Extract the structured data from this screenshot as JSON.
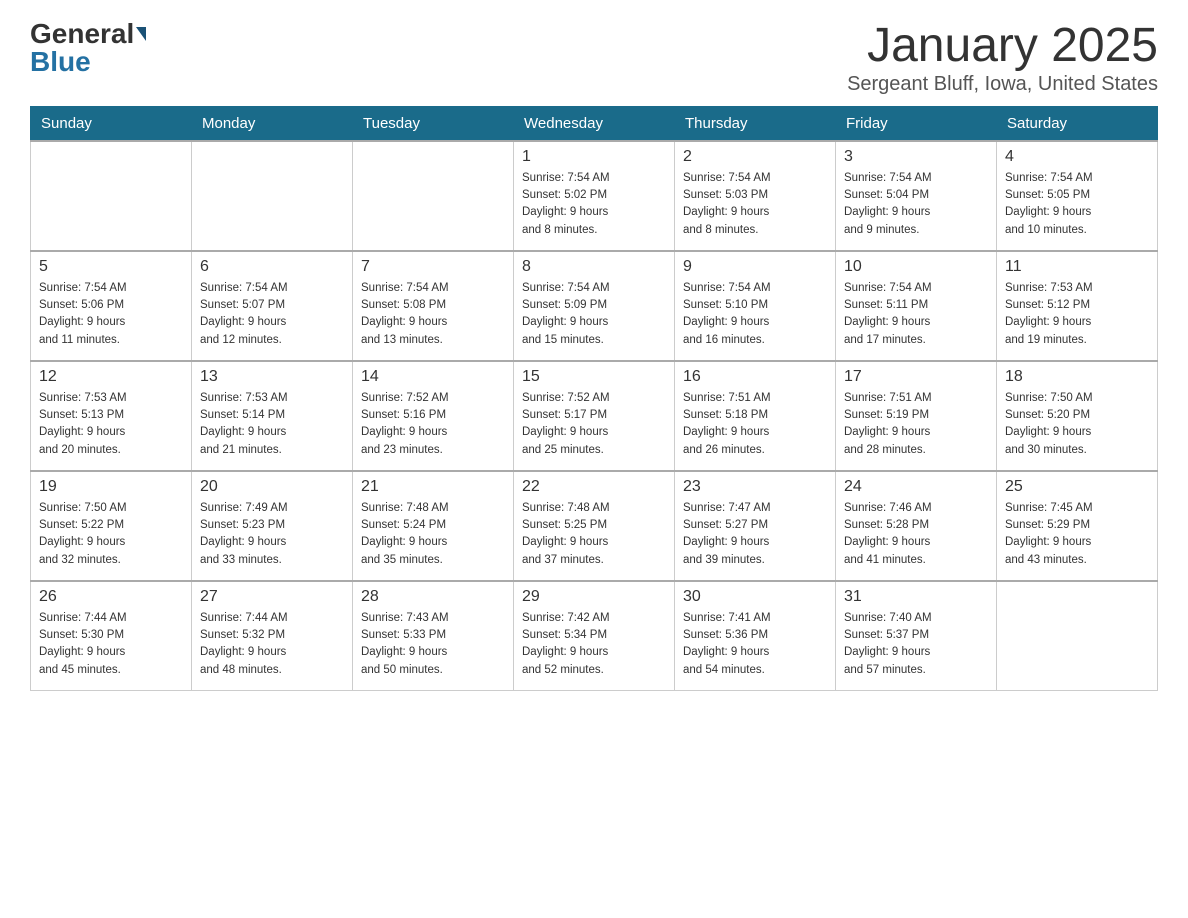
{
  "logo": {
    "general": "General",
    "blue": "Blue"
  },
  "title": "January 2025",
  "location": "Sergeant Bluff, Iowa, United States",
  "days_of_week": [
    "Sunday",
    "Monday",
    "Tuesday",
    "Wednesday",
    "Thursday",
    "Friday",
    "Saturday"
  ],
  "weeks": [
    [
      {
        "day": "",
        "info": ""
      },
      {
        "day": "",
        "info": ""
      },
      {
        "day": "",
        "info": ""
      },
      {
        "day": "1",
        "info": "Sunrise: 7:54 AM\nSunset: 5:02 PM\nDaylight: 9 hours\nand 8 minutes."
      },
      {
        "day": "2",
        "info": "Sunrise: 7:54 AM\nSunset: 5:03 PM\nDaylight: 9 hours\nand 8 minutes."
      },
      {
        "day": "3",
        "info": "Sunrise: 7:54 AM\nSunset: 5:04 PM\nDaylight: 9 hours\nand 9 minutes."
      },
      {
        "day": "4",
        "info": "Sunrise: 7:54 AM\nSunset: 5:05 PM\nDaylight: 9 hours\nand 10 minutes."
      }
    ],
    [
      {
        "day": "5",
        "info": "Sunrise: 7:54 AM\nSunset: 5:06 PM\nDaylight: 9 hours\nand 11 minutes."
      },
      {
        "day": "6",
        "info": "Sunrise: 7:54 AM\nSunset: 5:07 PM\nDaylight: 9 hours\nand 12 minutes."
      },
      {
        "day": "7",
        "info": "Sunrise: 7:54 AM\nSunset: 5:08 PM\nDaylight: 9 hours\nand 13 minutes."
      },
      {
        "day": "8",
        "info": "Sunrise: 7:54 AM\nSunset: 5:09 PM\nDaylight: 9 hours\nand 15 minutes."
      },
      {
        "day": "9",
        "info": "Sunrise: 7:54 AM\nSunset: 5:10 PM\nDaylight: 9 hours\nand 16 minutes."
      },
      {
        "day": "10",
        "info": "Sunrise: 7:54 AM\nSunset: 5:11 PM\nDaylight: 9 hours\nand 17 minutes."
      },
      {
        "day": "11",
        "info": "Sunrise: 7:53 AM\nSunset: 5:12 PM\nDaylight: 9 hours\nand 19 minutes."
      }
    ],
    [
      {
        "day": "12",
        "info": "Sunrise: 7:53 AM\nSunset: 5:13 PM\nDaylight: 9 hours\nand 20 minutes."
      },
      {
        "day": "13",
        "info": "Sunrise: 7:53 AM\nSunset: 5:14 PM\nDaylight: 9 hours\nand 21 minutes."
      },
      {
        "day": "14",
        "info": "Sunrise: 7:52 AM\nSunset: 5:16 PM\nDaylight: 9 hours\nand 23 minutes."
      },
      {
        "day": "15",
        "info": "Sunrise: 7:52 AM\nSunset: 5:17 PM\nDaylight: 9 hours\nand 25 minutes."
      },
      {
        "day": "16",
        "info": "Sunrise: 7:51 AM\nSunset: 5:18 PM\nDaylight: 9 hours\nand 26 minutes."
      },
      {
        "day": "17",
        "info": "Sunrise: 7:51 AM\nSunset: 5:19 PM\nDaylight: 9 hours\nand 28 minutes."
      },
      {
        "day": "18",
        "info": "Sunrise: 7:50 AM\nSunset: 5:20 PM\nDaylight: 9 hours\nand 30 minutes."
      }
    ],
    [
      {
        "day": "19",
        "info": "Sunrise: 7:50 AM\nSunset: 5:22 PM\nDaylight: 9 hours\nand 32 minutes."
      },
      {
        "day": "20",
        "info": "Sunrise: 7:49 AM\nSunset: 5:23 PM\nDaylight: 9 hours\nand 33 minutes."
      },
      {
        "day": "21",
        "info": "Sunrise: 7:48 AM\nSunset: 5:24 PM\nDaylight: 9 hours\nand 35 minutes."
      },
      {
        "day": "22",
        "info": "Sunrise: 7:48 AM\nSunset: 5:25 PM\nDaylight: 9 hours\nand 37 minutes."
      },
      {
        "day": "23",
        "info": "Sunrise: 7:47 AM\nSunset: 5:27 PM\nDaylight: 9 hours\nand 39 minutes."
      },
      {
        "day": "24",
        "info": "Sunrise: 7:46 AM\nSunset: 5:28 PM\nDaylight: 9 hours\nand 41 minutes."
      },
      {
        "day": "25",
        "info": "Sunrise: 7:45 AM\nSunset: 5:29 PM\nDaylight: 9 hours\nand 43 minutes."
      }
    ],
    [
      {
        "day": "26",
        "info": "Sunrise: 7:44 AM\nSunset: 5:30 PM\nDaylight: 9 hours\nand 45 minutes."
      },
      {
        "day": "27",
        "info": "Sunrise: 7:44 AM\nSunset: 5:32 PM\nDaylight: 9 hours\nand 48 minutes."
      },
      {
        "day": "28",
        "info": "Sunrise: 7:43 AM\nSunset: 5:33 PM\nDaylight: 9 hours\nand 50 minutes."
      },
      {
        "day": "29",
        "info": "Sunrise: 7:42 AM\nSunset: 5:34 PM\nDaylight: 9 hours\nand 52 minutes."
      },
      {
        "day": "30",
        "info": "Sunrise: 7:41 AM\nSunset: 5:36 PM\nDaylight: 9 hours\nand 54 minutes."
      },
      {
        "day": "31",
        "info": "Sunrise: 7:40 AM\nSunset: 5:37 PM\nDaylight: 9 hours\nand 57 minutes."
      },
      {
        "day": "",
        "info": ""
      }
    ]
  ]
}
